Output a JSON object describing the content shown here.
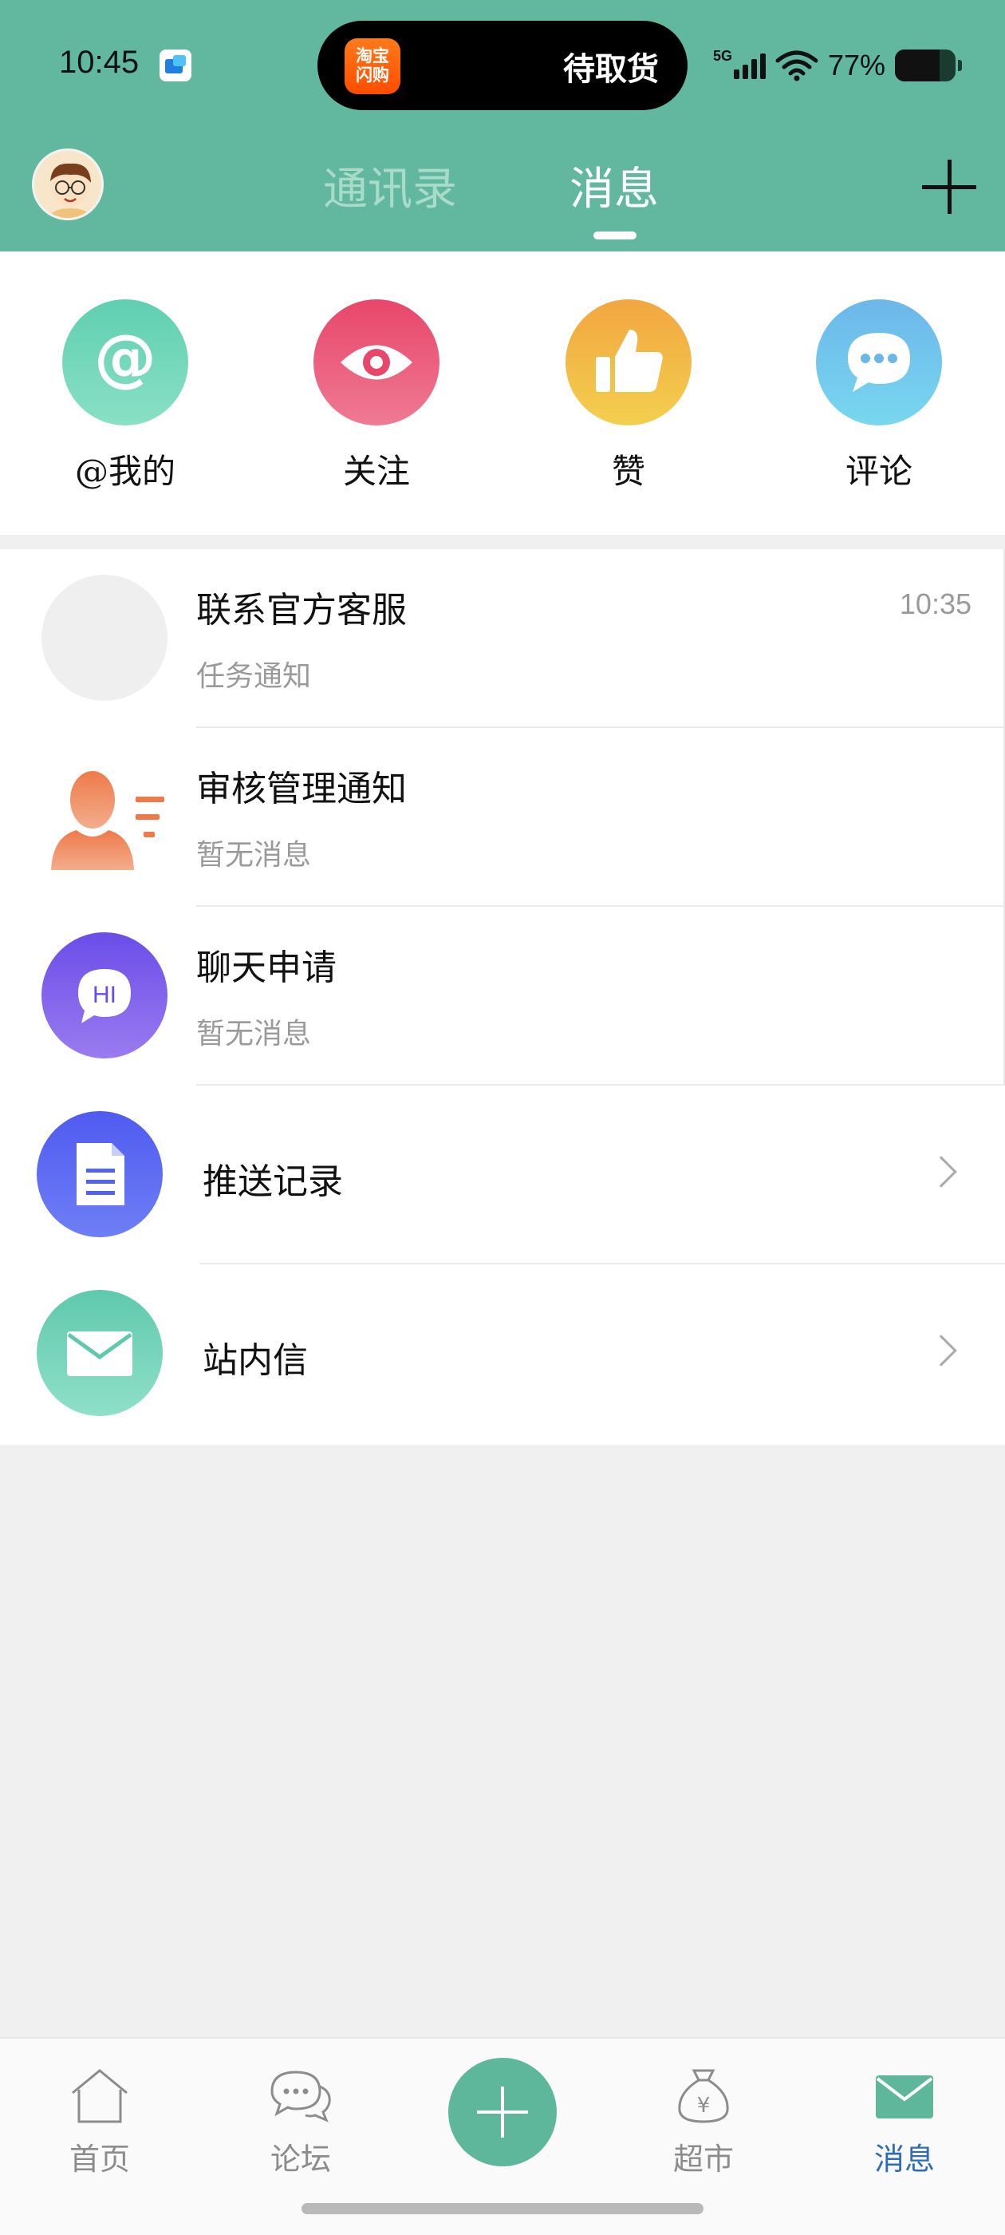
{
  "status_bar": {
    "time": "10:45",
    "island_app_label": "淘宝\n闪购",
    "island_text": "待取货",
    "network": "5G",
    "battery_percent": "77%"
  },
  "header": {
    "tabs": [
      {
        "label": "通讯录",
        "active": false
      },
      {
        "label": "消息",
        "active": true
      }
    ],
    "accent_color": "#62b89e"
  },
  "quick_actions": [
    {
      "label": "@我的",
      "icon": "at-icon"
    },
    {
      "label": "关注",
      "icon": "eye-icon"
    },
    {
      "label": "赞",
      "icon": "thumbs-up-icon"
    },
    {
      "label": "评论",
      "icon": "chat-bubble-icon"
    }
  ],
  "messages": [
    {
      "title": "联系官方客服",
      "subtitle": "任务通知",
      "time": "10:35",
      "icon": "placeholder-avatar"
    },
    {
      "title": "审核管理通知",
      "subtitle": "暂无消息",
      "icon": "person-list-icon"
    },
    {
      "title": "聊天申请",
      "subtitle": "暂无消息",
      "icon": "hi-chat-icon",
      "icon_text": "HI"
    },
    {
      "title": "推送记录",
      "icon": "document-icon"
    },
    {
      "title": "站内信",
      "icon": "mail-icon"
    }
  ],
  "bottom_nav": [
    {
      "label": "首页",
      "icon": "home-icon"
    },
    {
      "label": "论坛",
      "icon": "forum-icon"
    },
    {
      "label": "",
      "icon": "plus-icon"
    },
    {
      "label": "超市",
      "icon": "money-bag-icon",
      "icon_text": "¥"
    },
    {
      "label": "消息",
      "icon": "mail-icon",
      "active": true
    }
  ]
}
